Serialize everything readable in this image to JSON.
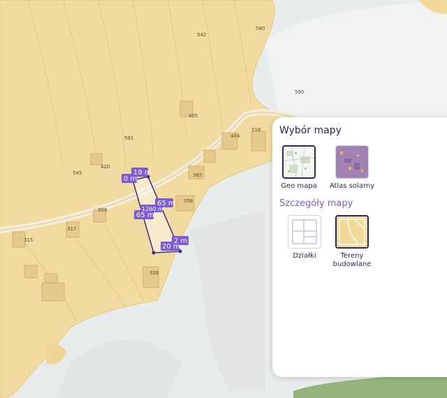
{
  "map": {
    "parcel_numbers": [
      "542",
      "580",
      "590",
      "405",
      "404",
      "518",
      "581",
      "420",
      "545",
      "365",
      "358",
      "209",
      "317",
      "315",
      "326"
    ],
    "measurements": [
      "0 m",
      "19 m",
      "65 m",
      "65 m",
      "1260 m²",
      "2 m",
      "20 m"
    ]
  },
  "panel": {
    "title": "Wybór mapy",
    "base_maps": [
      {
        "label": "Geo mapa",
        "selected": true
      },
      {
        "label": "Atlas solarny",
        "selected": false
      }
    ],
    "details_title": "Szczegóły mapy",
    "details": [
      {
        "label": "Działki",
        "selected": false
      },
      {
        "label": "Tereny budowlane",
        "selected": true
      }
    ]
  },
  "colors": {
    "building_zone": "#f2d998",
    "terrain": "#e6e9ea",
    "accent": "#7b5bd6",
    "primary_text": "#2d2660"
  }
}
